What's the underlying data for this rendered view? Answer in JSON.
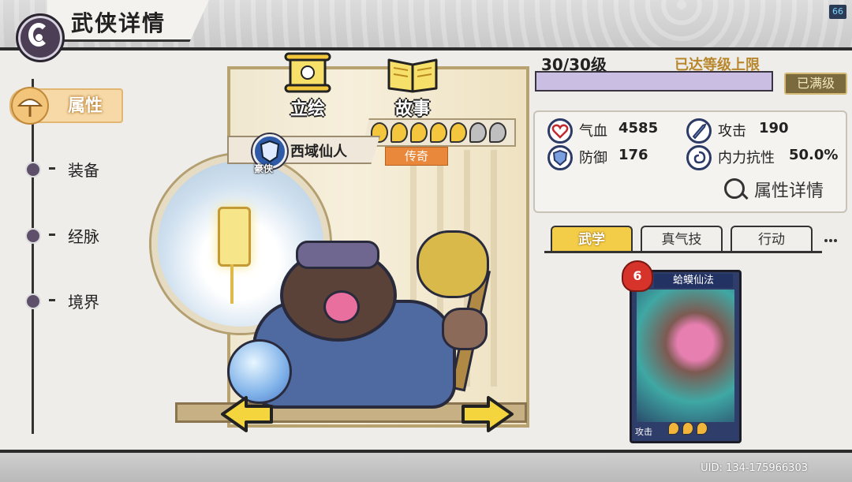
{
  "header": {
    "title": "武侠详情",
    "fps": "66"
  },
  "nav": {
    "items": [
      {
        "label": "属性",
        "selected": true
      },
      {
        "label": "装备"
      },
      {
        "label": "经脉"
      },
      {
        "label": "境界"
      }
    ]
  },
  "stage": {
    "buttons": [
      {
        "label": "立绘",
        "icon": "scroll-icon"
      },
      {
        "label": "故事",
        "icon": "book-icon"
      }
    ],
    "hero_name": "西域仙人",
    "faction": "豪侠",
    "rarity": "传奇",
    "stars": {
      "filled": 5,
      "total": 7
    }
  },
  "level": {
    "text": "30/30级",
    "cap_text": "已达等级上限",
    "maxed_label": "已满级",
    "progress": 1.0
  },
  "stats": [
    {
      "label": "气血",
      "value": "4585",
      "icon": "heart-icon"
    },
    {
      "label": "攻击",
      "value": "190",
      "icon": "sword-icon"
    },
    {
      "label": "防御",
      "value": "176",
      "icon": "shield-icon"
    },
    {
      "label": "内力抗性",
      "value": "50.0%",
      "icon": "swirl-icon"
    }
  ],
  "detail_button": "属性详情",
  "tabs": [
    {
      "label": "武学",
      "active": true
    },
    {
      "label": "真气技"
    },
    {
      "label": "行动"
    }
  ],
  "skill_card": {
    "name": "蛤蟆仙法",
    "level": "6",
    "type": "攻击",
    "pips": 3
  },
  "footer": {
    "uid": "UID: 134-175966303"
  },
  "colors": {
    "accent": "#f3cc48",
    "rarity": "#e9873a",
    "level_fill": "#cabfe2",
    "faction": "#2f5aa8"
  }
}
